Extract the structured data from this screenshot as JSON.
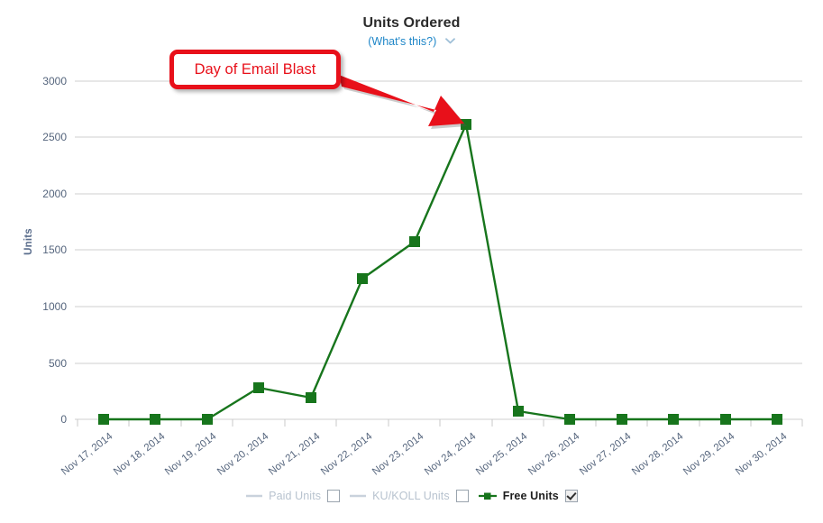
{
  "header": {
    "title": "Units Ordered",
    "whats_this_label": "(What's this?)",
    "chevron_icon": "chevron-down-icon"
  },
  "annotation": {
    "text": "Day of Email Blast",
    "color": "#e8101a",
    "arrow_icon": "arrow-pointer-icon",
    "points_to": "Nov 24, 2014"
  },
  "legend": {
    "items": [
      {
        "label": "Paid Units",
        "checked": false,
        "color": "#c9d2dc"
      },
      {
        "label": "KU/KOLL Units",
        "checked": false,
        "color": "#c9d2dc"
      },
      {
        "label": "Free Units",
        "checked": true,
        "color": "#17751c"
      }
    ]
  },
  "chart_data": {
    "type": "line",
    "title": "Units Ordered",
    "xlabel": "",
    "ylabel": "Units",
    "ylim": [
      0,
      3000
    ],
    "yticks": [
      0,
      500,
      1000,
      1500,
      2000,
      2500,
      3000
    ],
    "ytick_labels": [
      "0",
      "500",
      "1000",
      "1500",
      "2000",
      "2500",
      "3000"
    ],
    "grid": true,
    "legend_position": "bottom",
    "categories": [
      "Nov 17, 2014",
      "Nov 18, 2014",
      "Nov 19, 2014",
      "Nov 20, 2014",
      "Nov 21, 2014",
      "Nov 22, 2014",
      "Nov 23, 2014",
      "Nov 24, 2014",
      "Nov 25, 2014",
      "Nov 26, 2014",
      "Nov 27, 2014",
      "Nov 28, 2014",
      "Nov 29, 2014",
      "Nov 30, 2014"
    ],
    "series": [
      {
        "name": "Free Units",
        "color": "#17751c",
        "visible": true,
        "values": [
          0,
          0,
          0,
          280,
          190,
          1250,
          1570,
          2600,
          70,
          0,
          0,
          0,
          0,
          0
        ]
      },
      {
        "name": "Paid Units",
        "color": "#c9d2dc",
        "visible": false,
        "values": []
      },
      {
        "name": "KU/KOLL Units",
        "color": "#c9d2dc",
        "visible": false,
        "values": []
      }
    ]
  }
}
